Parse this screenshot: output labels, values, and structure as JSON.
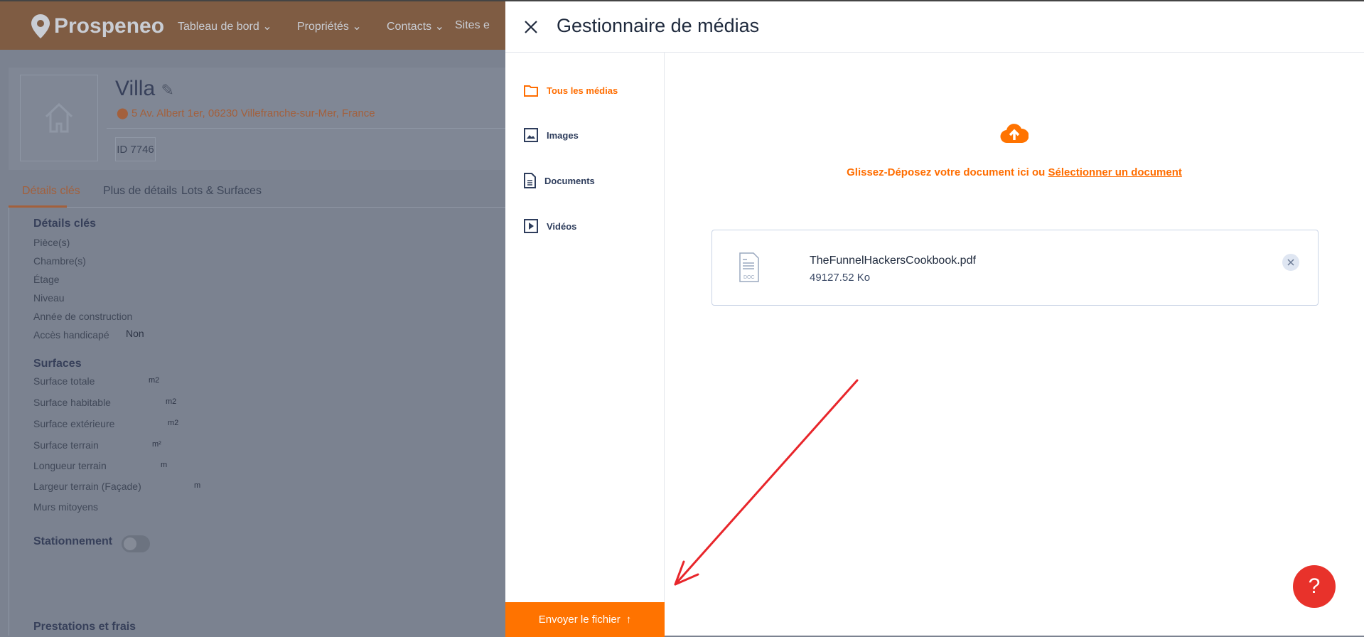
{
  "app": {
    "logo": "Prospeneo",
    "nav": [
      "Tableau de bord",
      "Propriétés",
      "Contacts",
      "Sites e"
    ]
  },
  "property": {
    "title": "Villa",
    "address": "5 Av. Albert 1er, 06230 Villefranche-sur-Mer, France",
    "id": "ID 7746",
    "tabs": [
      "Détails clés",
      "Plus de détails",
      "Lots & Surfaces"
    ],
    "key_details": {
      "heading": "Détails clés",
      "rows": [
        "Pièce(s)",
        "Chambre(s)",
        "Étage",
        "Niveau",
        "Année de construction",
        "Accès handicapé"
      ],
      "accessible_value": "Non"
    },
    "surfaces": {
      "heading": "Surfaces",
      "rows": [
        {
          "label": "Surface totale",
          "unit": "m2"
        },
        {
          "label": "Surface habitable",
          "unit": "m2"
        },
        {
          "label": "Surface extérieure",
          "unit": "m2"
        },
        {
          "label": "Surface terrain",
          "unit": "m²"
        },
        {
          "label": "Longueur terrain",
          "unit": "m"
        },
        {
          "label": "Largeur terrain (Façade)",
          "unit": "m"
        },
        {
          "label": "Murs mitoyens",
          "unit": ""
        }
      ]
    },
    "parking": {
      "label": "Stationnement",
      "enabled": false
    },
    "next_heading": "Prestations et frais"
  },
  "media": {
    "title": "Gestionnaire de médias",
    "sidebar": [
      {
        "label": "Tous les médias",
        "icon": "folder-icon"
      },
      {
        "label": "Images",
        "icon": "image-icon"
      },
      {
        "label": "Documents",
        "icon": "document-icon"
      },
      {
        "label": "Vidéos",
        "icon": "video-icon"
      }
    ],
    "drop_text": "Glissez-Déposez votre document ici ou ",
    "drop_link": "Sélectionner un document",
    "file": {
      "name": "TheFunnelHackersCookbook.pdf",
      "size": "49127.52 Ko",
      "icon_label": "DOC"
    },
    "send_label": "Envoyer le fichier"
  },
  "help": "?",
  "colors": {
    "accent": "#ff7300",
    "help": "#e8322b",
    "annotation": "#e8262b"
  }
}
